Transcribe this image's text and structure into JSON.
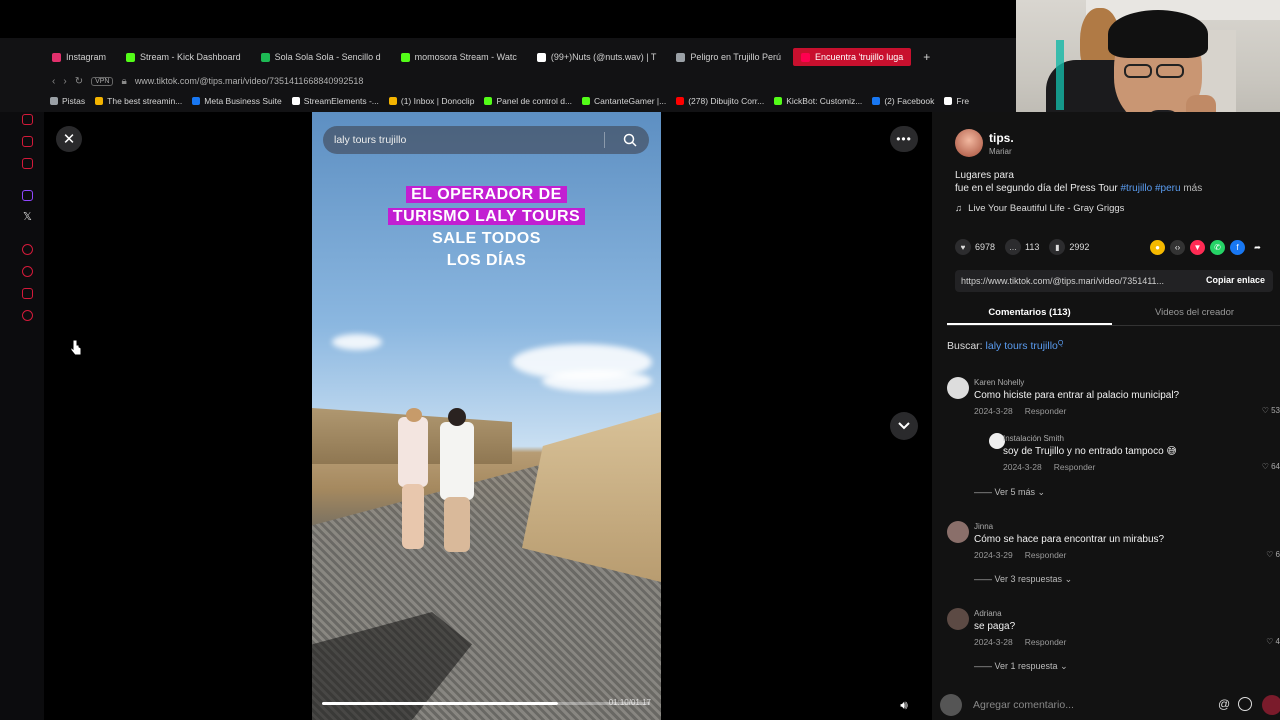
{
  "browser": {
    "tabs": [
      {
        "label": "Instagram",
        "color": "#e1306c"
      },
      {
        "label": "Stream - Kick Dashboard",
        "color": "#53fc18"
      },
      {
        "label": "Sola Sola Sola - Sencillo d",
        "color": "#1db954"
      },
      {
        "label": "momosora Stream - Watc",
        "color": "#53fc18"
      },
      {
        "label": "(99+)Nuts (@nuts.wav) | T",
        "color": "#ffffff"
      },
      {
        "label": "Peligro en Trujillo Perú",
        "color": "#9aa0a6"
      },
      {
        "label": "Encuentra 'trujillo luga",
        "color": "#ff0050"
      }
    ],
    "address": {
      "vpn_label": "VPN",
      "url": "www.tiktok.com/@tips.mari/video/7351411668840992518"
    },
    "bookmarks": [
      {
        "label": "Pistas",
        "color": "#9aa0a6"
      },
      {
        "label": "The best streamin...",
        "color": "#f4b400"
      },
      {
        "label": "Meta Business Suite",
        "color": "#1877f2"
      },
      {
        "label": "StreamElements -...",
        "color": "#ffffff"
      },
      {
        "label": "(1) Inbox | Donoclip",
        "color": "#f4b400"
      },
      {
        "label": "Panel de control d...",
        "color": "#53fc18"
      },
      {
        "label": "CantanteGamer |...",
        "color": "#53fc18"
      },
      {
        "label": "(278) Dibujito Corr...",
        "color": "#ff0000"
      },
      {
        "label": "KickBot: Customiz...",
        "color": "#53fc18"
      },
      {
        "label": "(2) Facebook",
        "color": "#1877f2"
      },
      {
        "label": "Fre",
        "color": "#ffffff"
      }
    ]
  },
  "video": {
    "search_text": "laly tours trujillo",
    "overlay_highlight": [
      "EL OPERADOR DE",
      "TURISMO LALY TOURS"
    ],
    "overlay_plain": [
      "SALE TODOS",
      "LOS DÍAS"
    ],
    "progress": 0.72,
    "time": "01:10/01:17"
  },
  "panel": {
    "author": "tips.",
    "author_sub": "Mariar",
    "description": "Lugares para",
    "description_line2": "fue en el segundo día del Press Tour",
    "tags": "#trujillo #peru",
    "more": "más",
    "music": "Live Your Beautiful Life - Gray Griggs",
    "likes": "6978",
    "comments": "113",
    "saves": "2992",
    "link": "https://www.tiktok.com/@tips.mari/video/7351411...",
    "copy_label": "Copiar enlace",
    "tab_comments": "Comentarios (113)",
    "tab_creator": "Videos del creador",
    "search_label": "Buscar:",
    "search_query": "laly tours trujillo",
    "comments_list": [
      {
        "name": "Karen Nohelly",
        "text": "Como hiciste para entrar al palacio municipal?",
        "date": "2024-3-28",
        "reply": "Responder",
        "likes": "53"
      },
      {
        "name": "Instalación Smith",
        "text": "soy de Trujillo y no entrado tampoco 😅",
        "date": "2024-3-28",
        "reply": "Responder",
        "likes": "64"
      },
      {
        "name": "Jinna",
        "text": "Cómo se hace para encontrar un mirabus?",
        "date": "2024-3-29",
        "reply": "Responder",
        "likes": "6"
      },
      {
        "name": "Adriana",
        "text": "se paga?",
        "date": "2024-3-28",
        "reply": "Responder",
        "likes": "4"
      }
    ],
    "view_more_1": "Ver 5 más",
    "view_more_2": "Ver 3 respuestas",
    "view_more_3": "Ver 1 respuesta",
    "comment_placeholder": "Agregar comentario..."
  },
  "colors": {
    "accent": "#c8102e",
    "overlay_highlight": "#c21fd2",
    "link_blue": "#5a9cf0"
  }
}
